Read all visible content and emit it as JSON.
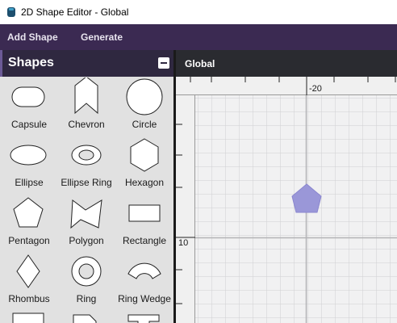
{
  "window": {
    "title": "2D Shape Editor - Global"
  },
  "menu": {
    "items": [
      {
        "label": "Add Shape"
      },
      {
        "label": "Generate"
      }
    ]
  },
  "shapes_panel": {
    "title": "Shapes",
    "items": [
      {
        "label": "Capsule",
        "icon": "capsule-icon"
      },
      {
        "label": "Chevron",
        "icon": "chevron-icon"
      },
      {
        "label": "Circle",
        "icon": "circle-icon"
      },
      {
        "label": "Ellipse",
        "icon": "ellipse-icon"
      },
      {
        "label": "Ellipse Ring",
        "icon": "ellipse-ring-icon"
      },
      {
        "label": "Hexagon",
        "icon": "hexagon-icon"
      },
      {
        "label": "Pentagon",
        "icon": "pentagon-icon"
      },
      {
        "label": "Polygon",
        "icon": "polygon-icon"
      },
      {
        "label": "Rectangle",
        "icon": "rectangle-icon"
      },
      {
        "label": "Rhombus",
        "icon": "rhombus-icon"
      },
      {
        "label": "Ring",
        "icon": "ring-icon"
      },
      {
        "label": "Ring Wedge",
        "icon": "ring-wedge-icon"
      }
    ]
  },
  "canvas": {
    "title": "Global",
    "ruler_top_label": "-20",
    "ruler_left_label": "10",
    "shape": {
      "type": "pentagon",
      "fill": "#9a97d8"
    }
  },
  "colors": {
    "menubar": "#3b2a52",
    "panel_header": "#2f2840",
    "canvas_header": "#2a2b30",
    "accent": "#6b5a96"
  }
}
